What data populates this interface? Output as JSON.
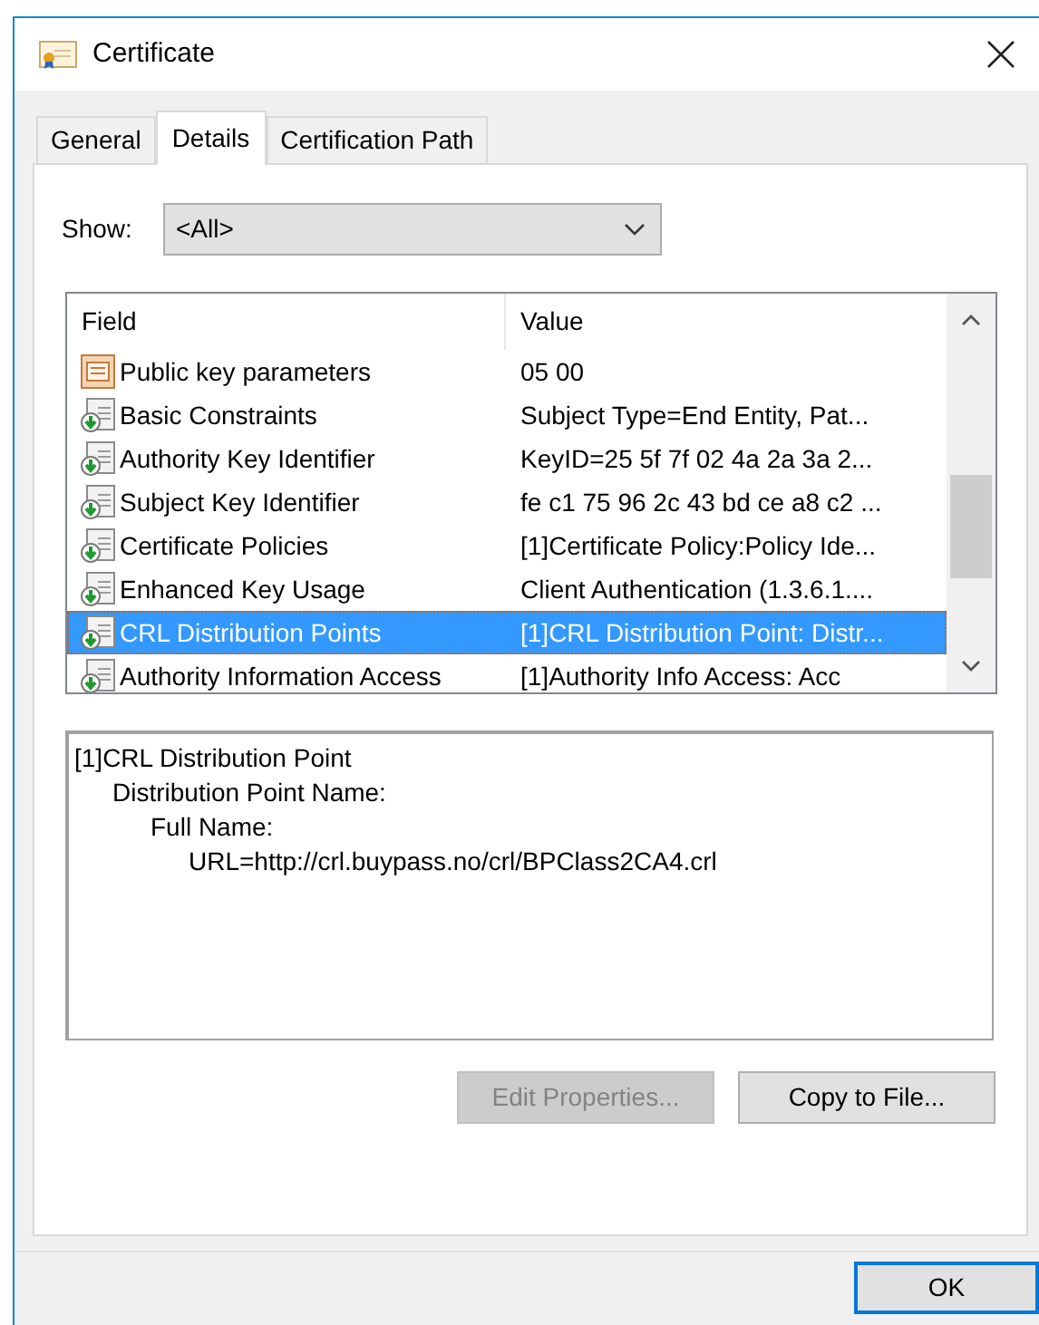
{
  "window": {
    "title": "Certificate"
  },
  "tabs": [
    {
      "label": "General",
      "selected": false
    },
    {
      "label": "Details",
      "selected": true
    },
    {
      "label": "Certification Path",
      "selected": false
    }
  ],
  "show": {
    "label": "Show:",
    "value": "<All>"
  },
  "table": {
    "columns": [
      "Field",
      "Value"
    ],
    "rows": [
      {
        "kind": "parameter",
        "field": "Public key parameters",
        "value": "05 00",
        "selected": false
      },
      {
        "kind": "extension",
        "field": "Basic Constraints",
        "value": "Subject Type=End Entity, Pat...",
        "selected": false
      },
      {
        "kind": "extension",
        "field": "Authority Key Identifier",
        "value": "KeyID=25 5f 7f 02 4a 2a 3a 2...",
        "selected": false
      },
      {
        "kind": "extension",
        "field": "Subject Key Identifier",
        "value": "fe c1 75 96 2c 43 bd ce a8 c2 ...",
        "selected": false
      },
      {
        "kind": "extension",
        "field": "Certificate Policies",
        "value": "[1]Certificate Policy:Policy Ide...",
        "selected": false
      },
      {
        "kind": "extension",
        "field": "Enhanced Key Usage",
        "value": "Client Authentication (1.3.6.1....",
        "selected": false
      },
      {
        "kind": "extension",
        "field": "CRL Distribution Points",
        "value": "[1]CRL Distribution Point: Distr...",
        "selected": true
      },
      {
        "kind": "extension",
        "field": "Authority Information Access",
        "value": "[1]Authority Info Access: Acc",
        "selected": false
      }
    ]
  },
  "detail": [
    {
      "text": "[1]CRL Distribution Point",
      "children": [
        {
          "text": "Distribution Point Name:",
          "children": [
            {
              "text": "Full Name:",
              "children": [
                {
                  "text": "URL=http://crl.buypass.no/crl/BPClass2CA4.crl"
                }
              ]
            }
          ]
        }
      ]
    }
  ],
  "buttons": [
    {
      "label": "Edit Properties...",
      "disabled": true
    },
    {
      "label": "Copy to File...",
      "disabled": false
    }
  ],
  "ok": {
    "label": "OK"
  }
}
